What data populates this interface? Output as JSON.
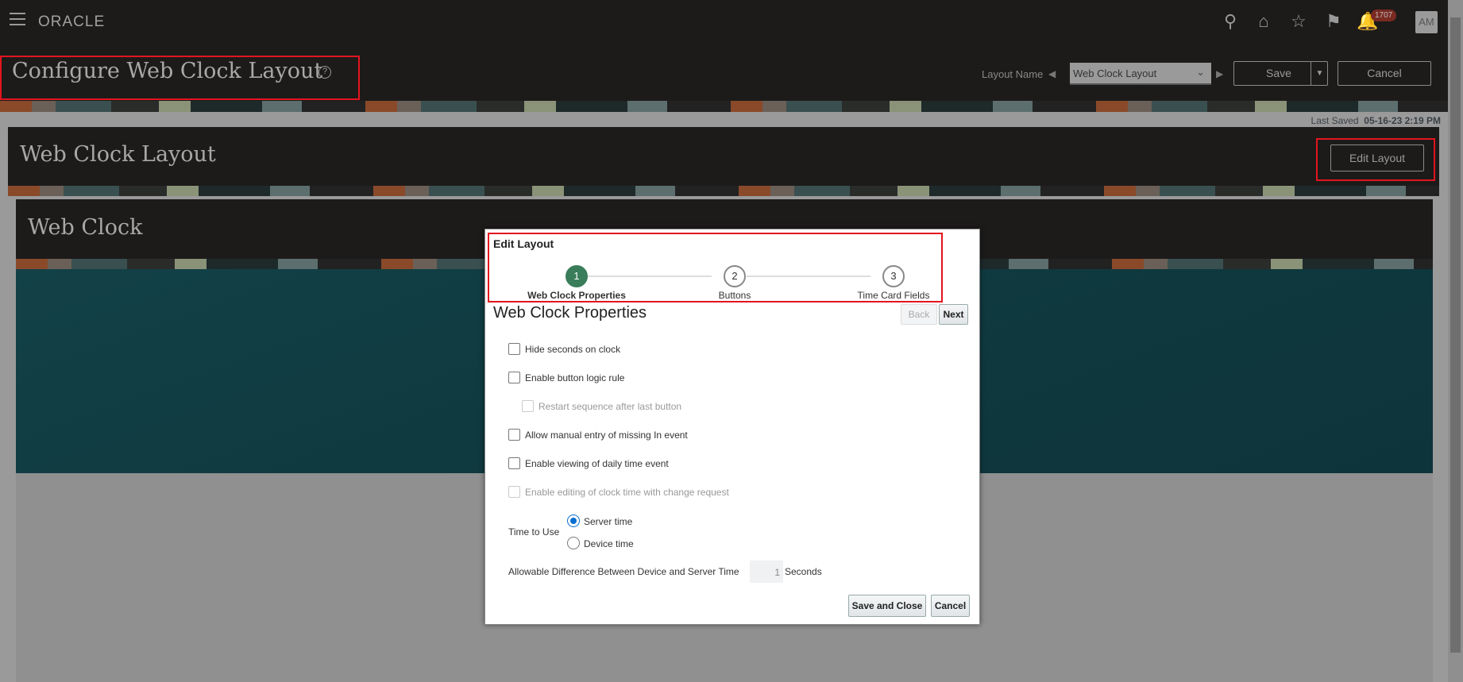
{
  "header": {
    "brand": "ORACLE",
    "notification_count": "1707",
    "avatar_initials": "AM"
  },
  "page": {
    "title": "Configure Web Clock Layout",
    "layout_name_label": "Layout Name",
    "layout_name_value": "Web Clock Layout",
    "save_label": "Save",
    "cancel_label": "Cancel",
    "last_saved_label": "Last Saved",
    "last_saved_value": "05-16-23 2:19 PM"
  },
  "layout_panel": {
    "title": "Web Clock Layout",
    "edit_button": "Edit Layout"
  },
  "web_clock_panel": {
    "title": "Web Clock"
  },
  "dialog": {
    "title": "Edit Layout",
    "steps": [
      {
        "num": "1",
        "label": "Web Clock Properties",
        "active": true
      },
      {
        "num": "2",
        "label": "Buttons"
      },
      {
        "num": "3",
        "label": "Time Card Fields"
      }
    ],
    "section_title": "Web Clock Properties",
    "back_label": "Back",
    "next_label": "Next",
    "options": [
      {
        "label": "Hide seconds on clock",
        "checked": false,
        "disabled": false
      },
      {
        "label": "Enable button logic rule",
        "checked": false,
        "disabled": false
      },
      {
        "label": "Restart sequence after last button",
        "checked": false,
        "disabled": true
      },
      {
        "label": "Allow manual entry of missing In event",
        "checked": false,
        "disabled": false
      },
      {
        "label": "Enable viewing of daily time event",
        "checked": false,
        "disabled": false
      },
      {
        "label": "Enable editing of clock time with change request",
        "checked": false,
        "disabled": true
      }
    ],
    "time_to_use_label": "Time to Use",
    "time_options": [
      {
        "label": "Server time",
        "selected": true
      },
      {
        "label": "Device time",
        "selected": false
      }
    ],
    "allowable_label": "Allowable Difference Between Device and Server Time",
    "allowable_value": "1",
    "allowable_unit": "Seconds",
    "save_close_label": "Save and Close",
    "cancel_label": "Cancel"
  },
  "colors": {
    "accent": "#3a7d5a",
    "highlight": "#e3141e",
    "radio": "#0a6ed1"
  }
}
